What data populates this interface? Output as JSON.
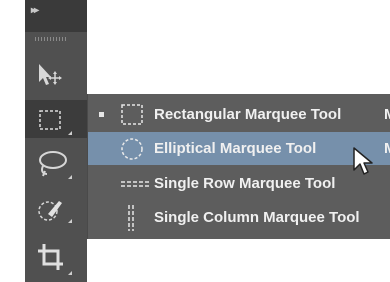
{
  "toolbar": {
    "collapse_glyph": "▸▸",
    "tools": [
      {
        "name": "move-tool",
        "icon": "move-arrow-icon"
      },
      {
        "name": "marquee-tool",
        "icon": "rectangular-marquee-icon",
        "active": true
      },
      {
        "name": "lasso-tool",
        "icon": "lasso-icon"
      },
      {
        "name": "quick-selection-tool",
        "icon": "quick-selection-brush-icon"
      },
      {
        "name": "crop-tool",
        "icon": "crop-icon"
      }
    ]
  },
  "flyout": {
    "items": [
      {
        "label": "Rectangular Marquee Tool",
        "shortcut": "M",
        "selected": true,
        "icon": "rectangular-marquee-icon"
      },
      {
        "label": "Elliptical Marquee Tool",
        "shortcut": "M",
        "hover": true,
        "icon": "elliptical-marquee-icon"
      },
      {
        "label": "Single Row Marquee Tool",
        "shortcut": "",
        "icon": "single-row-marquee-icon"
      },
      {
        "label": "Single Column Marquee Tool",
        "shortcut": "",
        "icon": "single-column-marquee-icon"
      }
    ]
  },
  "colors": {
    "toolbar_bg": "#505050",
    "flyout_bg": "#5d5d5d",
    "hover_bg": "#7690ab",
    "text": "#f0f0f0"
  }
}
